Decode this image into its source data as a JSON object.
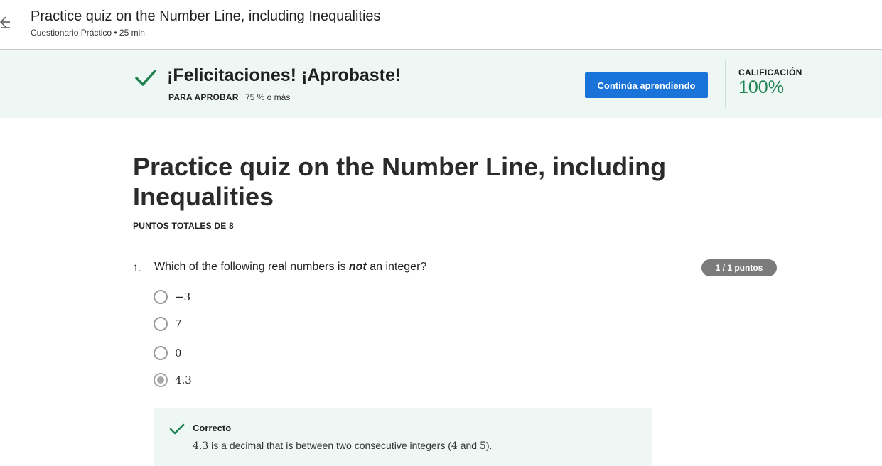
{
  "header": {
    "title": "Practice quiz on the Number Line, including Inequalities",
    "subtitle": "Cuestionario Práctico • 25 min"
  },
  "banner": {
    "title": "¡Felicitaciones! ¡Aprobaste!",
    "pass_label": "PARA APROBAR",
    "pass_value": "75 % o más",
    "continue_label": "Continúa aprendiendo",
    "grade_label": "CALIFICACIÓN",
    "grade_value": "100%"
  },
  "quiz": {
    "title": "Practice quiz on the Number Line, including Inequalities",
    "total_points": "PUNTOS TOTALES DE 8"
  },
  "question": {
    "number": "1.",
    "text_before": "Which of the following real numbers is ",
    "text_emph": "not",
    "text_after": " an integer?",
    "points": "1 / 1 puntos",
    "options": [
      {
        "label": "−3",
        "selected": false
      },
      {
        "label": "7",
        "selected": false
      },
      {
        "label": "0",
        "selected": false
      },
      {
        "label": "4.3",
        "selected": true
      }
    ],
    "feedback": {
      "title": "Correcto",
      "value": "4.3",
      "text_mid": " is a decimal that is between two consecutive integers (",
      "n1": "4",
      "text_and": " and ",
      "n2": "5",
      "text_end": ")."
    }
  },
  "colors": {
    "accent": "#1a73d9",
    "success": "#1f8354",
    "banner_bg": "#eef7f4",
    "badge_bg": "#7b7b7b"
  }
}
